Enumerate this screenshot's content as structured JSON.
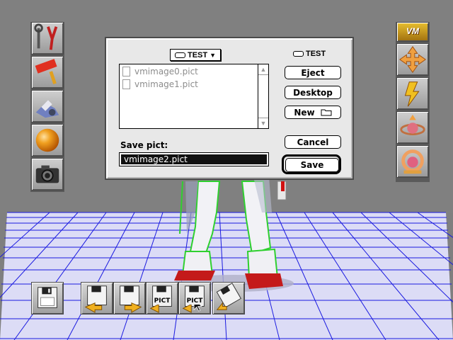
{
  "dialog": {
    "folder_popup": "TEST",
    "disk_name": "TEST",
    "files": [
      "vmimage0.pict",
      "vmimage1.pict"
    ],
    "buttons": {
      "eject": "Eject",
      "desktop": "Desktop",
      "new_folder": "New",
      "cancel": "Cancel",
      "save": "Save"
    },
    "save_prompt": "Save pict:",
    "filename_value": "vmimage2.pict"
  },
  "right_tools": {
    "logo_text": "VM"
  },
  "bottom_tools": {
    "pict_label_1": "PICT",
    "pict_label_2": "PICT"
  },
  "colors": {
    "background": "#7f7f7f",
    "grid_floor": "#dcdcf4",
    "grid_lines": "#1a1ae0",
    "wireframe": "#2fd02f",
    "robot_feet": "#c41a1a"
  }
}
